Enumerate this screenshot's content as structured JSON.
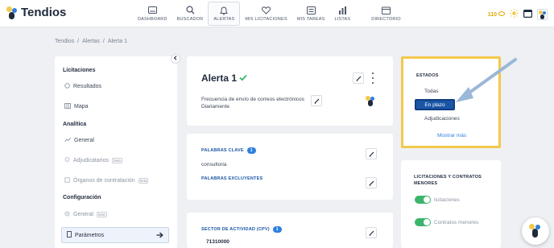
{
  "brand": {
    "name": "Tendios"
  },
  "nav": {
    "items": [
      {
        "label": "DASHBOARD",
        "icon": "dashboard-icon",
        "active": false
      },
      {
        "label": "BUSCADOR",
        "icon": "search-icon",
        "active": false
      },
      {
        "label": "ALERTAS",
        "icon": "bell-icon",
        "active": true
      },
      {
        "label": "MIS LICITACIONES",
        "icon": "heart-icon",
        "active": false
      },
      {
        "label": "MIS TAREAS",
        "icon": "tasks-icon",
        "active": false
      },
      {
        "label": "LISTAS",
        "icon": "chart-icon",
        "active": false
      },
      {
        "label": "DIRECTORIO",
        "icon": "directory-icon",
        "active": false
      }
    ]
  },
  "topright": {
    "credits": "110"
  },
  "breadcrumb": [
    "Tendios",
    "/",
    "Alertas",
    "/",
    "Alerta 1"
  ],
  "sidebar": {
    "sections": {
      "licitaciones": "Licitaciones",
      "analitica": "Analítica",
      "configuracion": "Configuración"
    },
    "items": {
      "resultados": "Resultados",
      "mapa": "Mapa",
      "general": "General",
      "adjudicatarios": "Adjudicatarios",
      "organos": "Órganos de contratación",
      "config_general": "General",
      "parametros": "Parámetros"
    },
    "beta": "beta"
  },
  "alert": {
    "title": "Alerta 1",
    "freq_line1": "Frecuencia de envío de correos electrónicos",
    "freq_line2": "Diariamente"
  },
  "keywords": {
    "label": "PALABRAS CLAVE",
    "count": "1",
    "value": "consultoria",
    "excluded_label": "PALABRAS EXCLUYENTES"
  },
  "sector": {
    "label": "SECTOR DE ACTIVIDAD (CPV)",
    "count": "1",
    "value": "71310000"
  },
  "estados": {
    "title": "ESTADOS",
    "options": {
      "todas": "Todas",
      "en_plazo": "En plazo",
      "adjudicaciones": "Adjudicaciones"
    },
    "more": "Mostrar más"
  },
  "contratos": {
    "title": "LICITACIONES Y CONTRATOS MENORES",
    "licitaciones": "licitaciones",
    "menores": "Contratos menores"
  },
  "colors": {
    "accent": "#1a56a6",
    "highlight": "#f2c94c",
    "toggle_on": "#3bb56b",
    "badge": "#2f7fe0"
  }
}
